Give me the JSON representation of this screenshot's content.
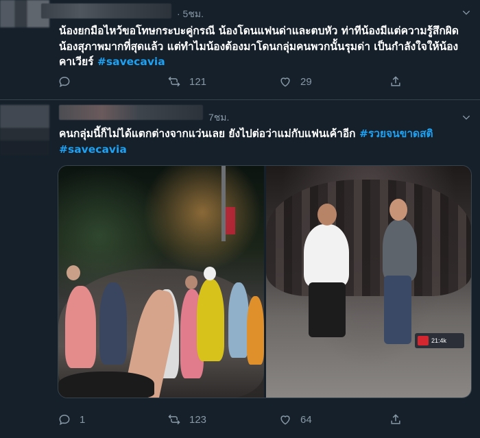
{
  "tweets": [
    {
      "time": "· 5ชม.",
      "text": "น้องยกมือไหว้ขอโทษกระบะคู่กรณี น้องโดนแฟนด่าและตบหัว ท่าทีน้องมีแต่ความรู้สึกผิด น้องสุภาพมากที่สุดแล้ว แต่ทำไมน้องต้องมาโดนกลุ่มคนพวกนั้นรุมด่า เป็นกำลังใจให้น้องคาเวียร์ ",
      "hashtags": [
        "#savecavia"
      ],
      "replies": "",
      "retweets": "121",
      "likes": "29"
    },
    {
      "time": "7ชม.",
      "text": "คนกลุ่มนี้ก็ไม่ได้แตกต่างจากแว่นเลย ยังไปต่อว่าแม่กับแฟนเค้าอีก ",
      "hashtags": [
        "#รวยจนขาดสติ",
        "#savecavia"
      ],
      "replies": "1",
      "retweets": "123",
      "likes": "64",
      "overlay_badge": "21:4k"
    }
  ],
  "icons": {
    "reply": "reply-icon",
    "retweet": "retweet-icon",
    "like": "heart-icon",
    "share": "share-icon",
    "more": "chevron-down-icon"
  },
  "colors": {
    "background": "#15202b",
    "text": "#ffffff",
    "muted": "#8899a6",
    "hashtag": "#1da1f2",
    "divider": "#38444d"
  }
}
